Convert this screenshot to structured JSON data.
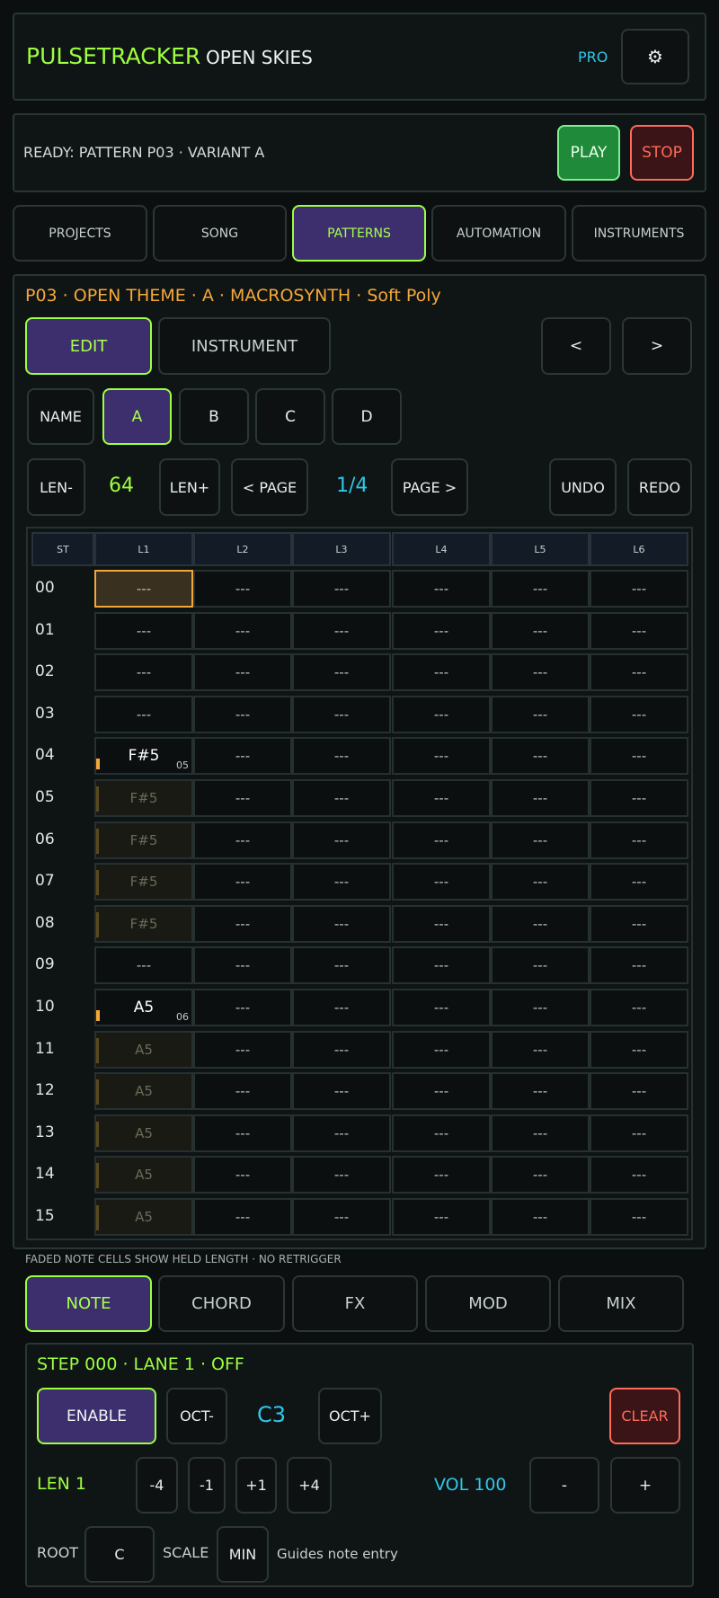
{
  "header": {
    "app_name": "PULSETRACKER",
    "project_name": "OPEN SKIES",
    "pro_label": "PRO",
    "settings_icon": "gear-icon"
  },
  "transport": {
    "status": "READY: PATTERN P03 · VARIANT A",
    "play_label": "PLAY",
    "stop_label": "STOP"
  },
  "tabs": [
    "PROJECTS",
    "SONG",
    "PATTERNS",
    "AUTOMATION",
    "INSTRUMENTS"
  ],
  "active_tab": "PATTERNS",
  "pattern": {
    "title": "P03 · OPEN THEME · A · MACROSYNTH · Soft Poly",
    "edit_label": "EDIT",
    "instrument_label": "INSTRUMENT",
    "prev_label": "<",
    "next_label": ">",
    "name_label": "NAME",
    "variants": [
      "A",
      "B",
      "C",
      "D"
    ],
    "active_variant": "A",
    "len_minus": "LEN-",
    "length": "64",
    "len_plus": "LEN+",
    "page_prev": "< PAGE",
    "page": "1/4",
    "page_next": "PAGE >",
    "undo": "UNDO",
    "redo": "REDO"
  },
  "grid": {
    "step_header": "ST",
    "lanes": [
      "L1",
      "L2",
      "L3",
      "L4",
      "L5",
      "L6"
    ],
    "rows": [
      {
        "step": "00",
        "cells": [
          "---",
          "---",
          "---",
          "---",
          "---",
          "---"
        ]
      },
      {
        "step": "01",
        "cells": [
          "---",
          "---",
          "---",
          "---",
          "---",
          "---"
        ]
      },
      {
        "step": "02",
        "cells": [
          "---",
          "---",
          "---",
          "---",
          "---",
          "---"
        ]
      },
      {
        "step": "03",
        "cells": [
          "---",
          "---",
          "---",
          "---",
          "---",
          "---"
        ]
      },
      {
        "step": "04",
        "cells": [
          "F#5",
          "---",
          "---",
          "---",
          "---",
          "---"
        ]
      },
      {
        "step": "05",
        "cells": [
          "F#5",
          "---",
          "---",
          "---",
          "---",
          "---"
        ]
      },
      {
        "step": "06",
        "cells": [
          "F#5",
          "---",
          "---",
          "---",
          "---",
          "---"
        ]
      },
      {
        "step": "07",
        "cells": [
          "F#5",
          "---",
          "---",
          "---",
          "---",
          "---"
        ]
      },
      {
        "step": "08",
        "cells": [
          "F#5",
          "---",
          "---",
          "---",
          "---",
          "---"
        ]
      },
      {
        "step": "09",
        "cells": [
          "---",
          "---",
          "---",
          "---",
          "---",
          "---"
        ]
      },
      {
        "step": "10",
        "cells": [
          "A5",
          "---",
          "---",
          "---",
          "---",
          "---"
        ]
      },
      {
        "step": "11",
        "cells": [
          "A5",
          "---",
          "---",
          "---",
          "---",
          "---"
        ]
      },
      {
        "step": "12",
        "cells": [
          "A5",
          "---",
          "---",
          "---",
          "---",
          "---"
        ]
      },
      {
        "step": "13",
        "cells": [
          "A5",
          "---",
          "---",
          "---",
          "---",
          "---"
        ]
      },
      {
        "step": "14",
        "cells": [
          "A5",
          "---",
          "---",
          "---",
          "---",
          "---"
        ]
      },
      {
        "step": "15",
        "cells": [
          "A5",
          "---",
          "---",
          "---",
          "---",
          "---"
        ]
      }
    ],
    "note_starts": [
      {
        "step": "04",
        "length": "05"
      },
      {
        "step": "10",
        "length": "06"
      }
    ],
    "held_steps": [
      "05",
      "06",
      "07",
      "08",
      "11",
      "12",
      "13",
      "14",
      "15"
    ],
    "cursor": {
      "step": "00",
      "lane": "L1"
    }
  },
  "hint": "FADED NOTE CELLS SHOW HELD LENGTH · NO RETRIGGER",
  "mode_tabs": [
    "NOTE",
    "CHORD",
    "FX",
    "MOD",
    "MIX"
  ],
  "active_mode": "NOTE",
  "editor": {
    "step_info": "STEP 000 · LANE 1 · OFF",
    "enable_label": "ENABLE",
    "oct_minus": "OCT-",
    "note": "C3",
    "oct_plus": "OCT+",
    "clear_label": "CLEAR",
    "len_label": "LEN 1",
    "len_steps": [
      "-4",
      "-1",
      "+1",
      "+4"
    ],
    "vol_label": "VOL 100",
    "vol_minus": "-",
    "vol_plus": "+",
    "root_label": "ROOT",
    "root_value": "C",
    "scale_label": "SCALE",
    "scale_value": "MIN",
    "scale_hint": "Guides note entry"
  },
  "colors": {
    "accent": "#9dff3f",
    "selected_bg": "#3d2f6e",
    "cyan": "#2ec8e8",
    "orange": "#f4a83a",
    "stop": "#ff6a5a",
    "play_bg": "#1f8a3a"
  }
}
